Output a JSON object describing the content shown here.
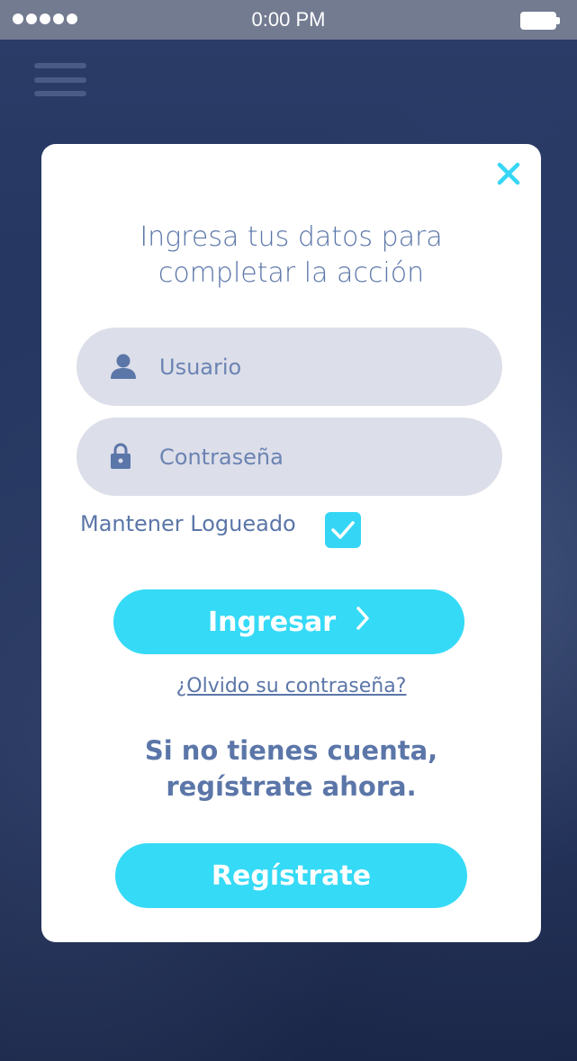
{
  "status_bar": {
    "time": "0:00 PM",
    "signal_icon": "signal-dots-icon",
    "battery_icon": "battery-icon"
  },
  "menu": {
    "icon": "hamburger-menu-icon"
  },
  "modal": {
    "close_icon": "close-icon",
    "heading_line1": "Ingresa tus datos para",
    "heading_line2": "completar la acción",
    "username_placeholder": "Usuario",
    "password_placeholder": "Contraseña",
    "remember_label": "Mantener Logueado",
    "remember_checked": true,
    "login_button": "Ingresar",
    "forgot_link": "¿Olvido su contraseña?",
    "signup_line1": "Si no tienes cuenta,",
    "signup_line2": "regístrate ahora.",
    "register_button": "Regístrate"
  },
  "colors": {
    "accent": "#35daf6",
    "text": "#5b76a8",
    "field_bg": "#dcdee9",
    "background": "#23345d"
  }
}
